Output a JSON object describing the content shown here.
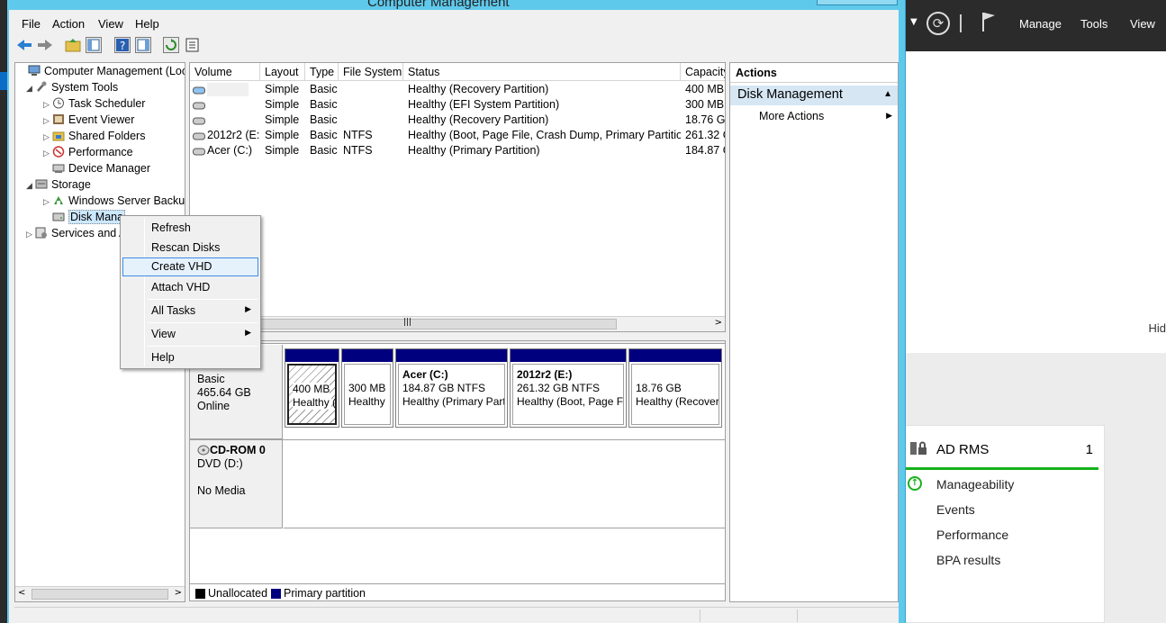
{
  "window": {
    "title": "Computer Management"
  },
  "menu": [
    "File",
    "Action",
    "View",
    "Help"
  ],
  "tree": {
    "items": [
      {
        "label": "Computer Management (Local",
        "level": 0,
        "tw": "",
        "icon": "computer-icon"
      },
      {
        "label": "System Tools",
        "level": 1,
        "tw": "◢",
        "icon": "tools-icon"
      },
      {
        "label": "Task Scheduler",
        "level": 2,
        "tw": "▷",
        "icon": "clock-icon"
      },
      {
        "label": "Event Viewer",
        "level": 2,
        "tw": "▷",
        "icon": "event-icon"
      },
      {
        "label": "Shared Folders",
        "level": 2,
        "tw": "▷",
        "icon": "folder-icon"
      },
      {
        "label": "Performance",
        "level": 2,
        "tw": "▷",
        "icon": "performance-icon"
      },
      {
        "label": "Device Manager",
        "level": 2,
        "tw": "",
        "icon": "device-icon"
      },
      {
        "label": "Storage",
        "level": 1,
        "tw": "◢",
        "icon": "storage-icon"
      },
      {
        "label": "Windows Server Backup",
        "level": 2,
        "tw": "▷",
        "icon": "backup-icon"
      },
      {
        "label": "Disk Mana",
        "level": 2,
        "tw": "",
        "icon": "disk-icon"
      },
      {
        "label": "Services and A",
        "level": 1,
        "tw": "▷",
        "icon": "services-icon"
      }
    ]
  },
  "volumes": {
    "columns": [
      "Volume",
      "Layout",
      "Type",
      "File System",
      "Status",
      "Capacity"
    ],
    "rows": [
      [
        "",
        "Simple",
        "Basic",
        "",
        "Healthy (Recovery Partition)",
        "400 MB"
      ],
      [
        "",
        "Simple",
        "Basic",
        "",
        "Healthy (EFI System Partition)",
        "300 MB"
      ],
      [
        "",
        "Simple",
        "Basic",
        "",
        "Healthy (Recovery Partition)",
        "18.76 GB"
      ],
      [
        "2012r2 (E:)",
        "Simple",
        "Basic",
        "NTFS",
        "Healthy (Boot, Page File, Crash Dump, Primary Partition)",
        "261.32 G"
      ],
      [
        "Acer (C:)",
        "Simple",
        "Basic",
        "NTFS",
        "Healthy (Primary Partition)",
        "184.87 G"
      ]
    ]
  },
  "disk0": {
    "type": "Basic",
    "size": "465.64 GB",
    "status": "Online",
    "partitions": [
      {
        "title": "",
        "size": "400 MB",
        "status": "Healthy ("
      },
      {
        "title": "",
        "size": "300 MB",
        "status": "Healthy"
      },
      {
        "title": "Acer  (C:)",
        "size": "184.87 GB NTFS",
        "status": "Healthy (Primary Part"
      },
      {
        "title": "2012r2  (E:)",
        "size": "261.32 GB NTFS",
        "status": "Healthy (Boot, Page F"
      },
      {
        "title": "",
        "size": "18.76 GB",
        "status": "Healthy (Recover"
      }
    ]
  },
  "cdrom0": {
    "name": "CD-ROM 0",
    "drive": "DVD (D:)",
    "media": "No Media"
  },
  "legend": {
    "unallocated": "Unallocated",
    "primary": "Primary partition"
  },
  "actions": {
    "header": "Actions",
    "section": "Disk Management",
    "more": "More Actions"
  },
  "context_menu": {
    "refresh": "Refresh",
    "rescan": "Rescan Disks",
    "create_vhd": "Create VHD",
    "attach_vhd": "Attach VHD",
    "all_tasks": "All Tasks",
    "view": "View",
    "help": "Help"
  },
  "server_manager": {
    "menu": [
      "Manage",
      "Tools",
      "View"
    ],
    "hide": "Hid",
    "tile": {
      "title": "AD RMS",
      "count": "1",
      "items": [
        "Manageability",
        "Events",
        "Performance",
        "BPA results"
      ]
    }
  },
  "colors": {
    "primary_partition": "#00007f",
    "accent": "#5fc9ec",
    "green": "#17b21a"
  }
}
